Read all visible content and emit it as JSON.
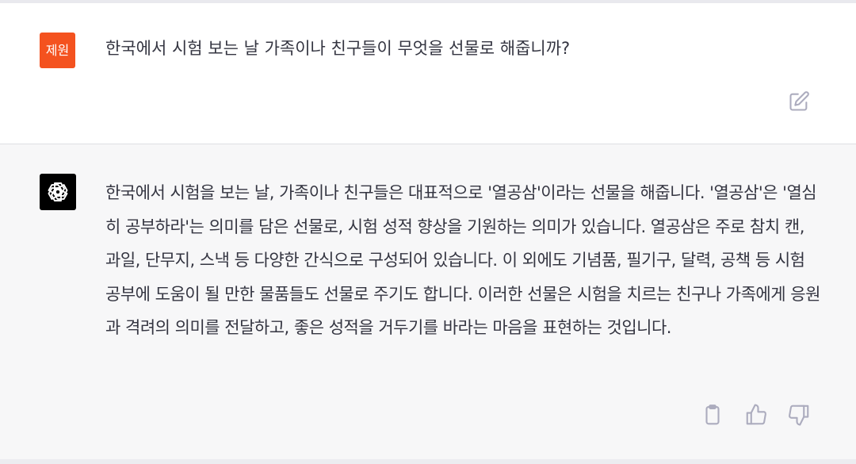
{
  "user": {
    "avatar_label": "제원",
    "avatar_color": "#f4521f",
    "message": "한국에서 시험 보는 날 가족이나 친구들이 무엇을 선물로 해줍니까?"
  },
  "assistant": {
    "avatar_color": "#000000",
    "message": "한국에서 시험을 보는 날, 가족이나 친구들은 대표적으로 '열공삼'이라는 선물을 해줍니다. '열공삼'은 '열심히 공부하라'는 의미를 담은 선물로, 시험 성적 향상을 기원하는 의미가 있습니다. 열공삼은 주로 참치 캔, 과일, 단무지, 스낵 등 다양한 간식으로 구성되어 있습니다. 이 외에도 기념품, 필기구, 달력, 공책 등 시험 공부에 도움이 될 만한 물품들도 선물로 주기도 합니다. 이러한 선물은 시험을 치르는 친구나 가족에게 응원과 격려의 의미를 전달하고, 좋은 성적을 거두기를 바라는 마음을 표현하는 것입니다."
  },
  "icons": {
    "edit": "edit-icon",
    "copy": "clipboard-icon",
    "thumb_up": "thumbs-up-icon",
    "thumb_down": "thumbs-down-icon"
  },
  "colors": {
    "user_bg": "#ffffff",
    "assistant_bg": "#f7f7f8",
    "text": "#343541",
    "icon": "#acacbe"
  }
}
